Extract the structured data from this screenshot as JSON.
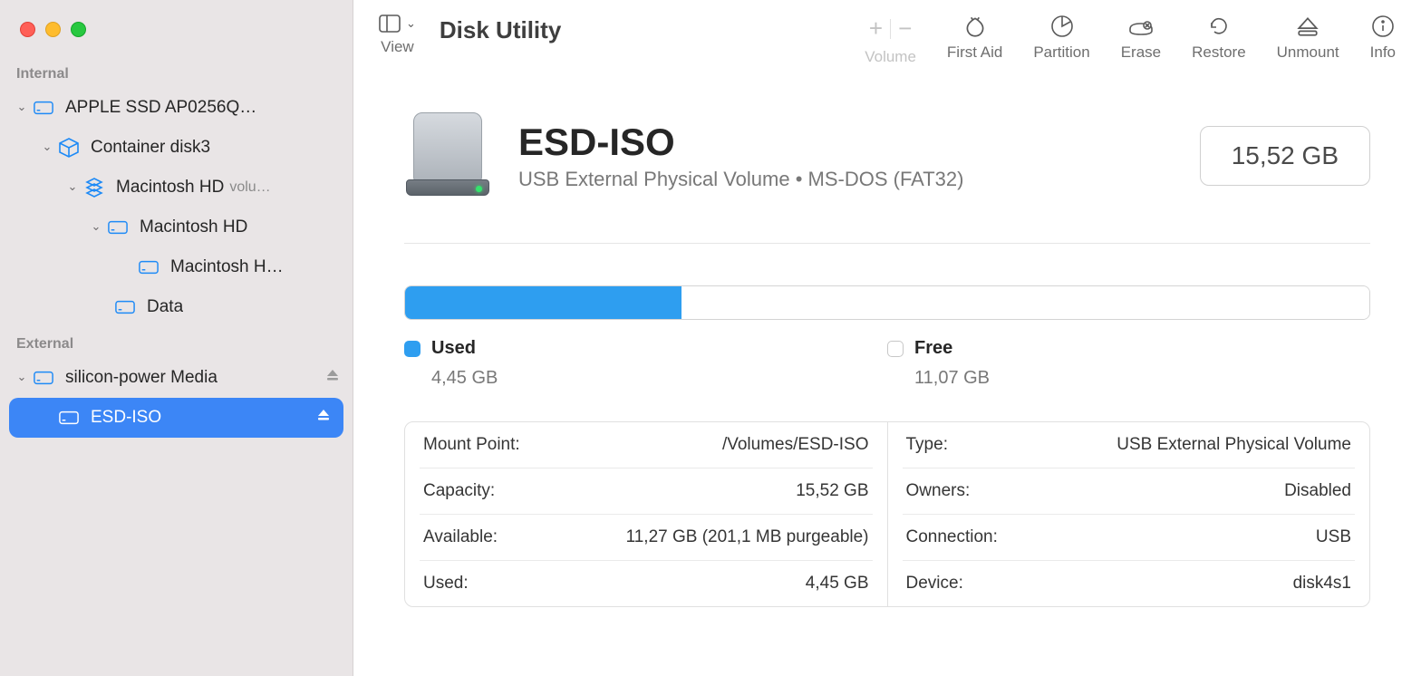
{
  "app_title": "Disk Utility",
  "toolbar": {
    "view_label": "View",
    "volume_label": "Volume",
    "first_aid_label": "First Aid",
    "partition_label": "Partition",
    "erase_label": "Erase",
    "restore_label": "Restore",
    "unmount_label": "Unmount",
    "info_label": "Info"
  },
  "sidebar": {
    "section_internal": "Internal",
    "section_external": "External",
    "items": [
      {
        "label": "APPLE SSD AP0256Q…",
        "sublabel": ""
      },
      {
        "label": "Container disk3",
        "sublabel": ""
      },
      {
        "label": "Macintosh HD",
        "sublabel": "volu…"
      },
      {
        "label": "Macintosh HD",
        "sublabel": ""
      },
      {
        "label": "Macintosh H…",
        "sublabel": ""
      },
      {
        "label": "Data",
        "sublabel": ""
      },
      {
        "label": "silicon-power Media",
        "sublabel": ""
      },
      {
        "label": "ESD-ISO",
        "sublabel": ""
      }
    ]
  },
  "volume": {
    "name": "ESD-ISO",
    "subtitle": "USB External Physical Volume • MS-DOS (FAT32)",
    "capacity_box": "15,52 GB",
    "used_label": "Used",
    "used_value": "4,45 GB",
    "free_label": "Free",
    "free_value": "11,07 GB"
  },
  "details_left": [
    {
      "key": "Mount Point:",
      "val": "/Volumes/ESD-ISO"
    },
    {
      "key": "Capacity:",
      "val": "15,52 GB"
    },
    {
      "key": "Available:",
      "val": "11,27 GB (201,1 MB purgeable)"
    },
    {
      "key": "Used:",
      "val": "4,45 GB"
    }
  ],
  "details_right": [
    {
      "key": "Type:",
      "val": "USB External Physical Volume"
    },
    {
      "key": "Owners:",
      "val": "Disabled"
    },
    {
      "key": "Connection:",
      "val": "USB"
    },
    {
      "key": "Device:",
      "val": "disk4s1"
    }
  ]
}
